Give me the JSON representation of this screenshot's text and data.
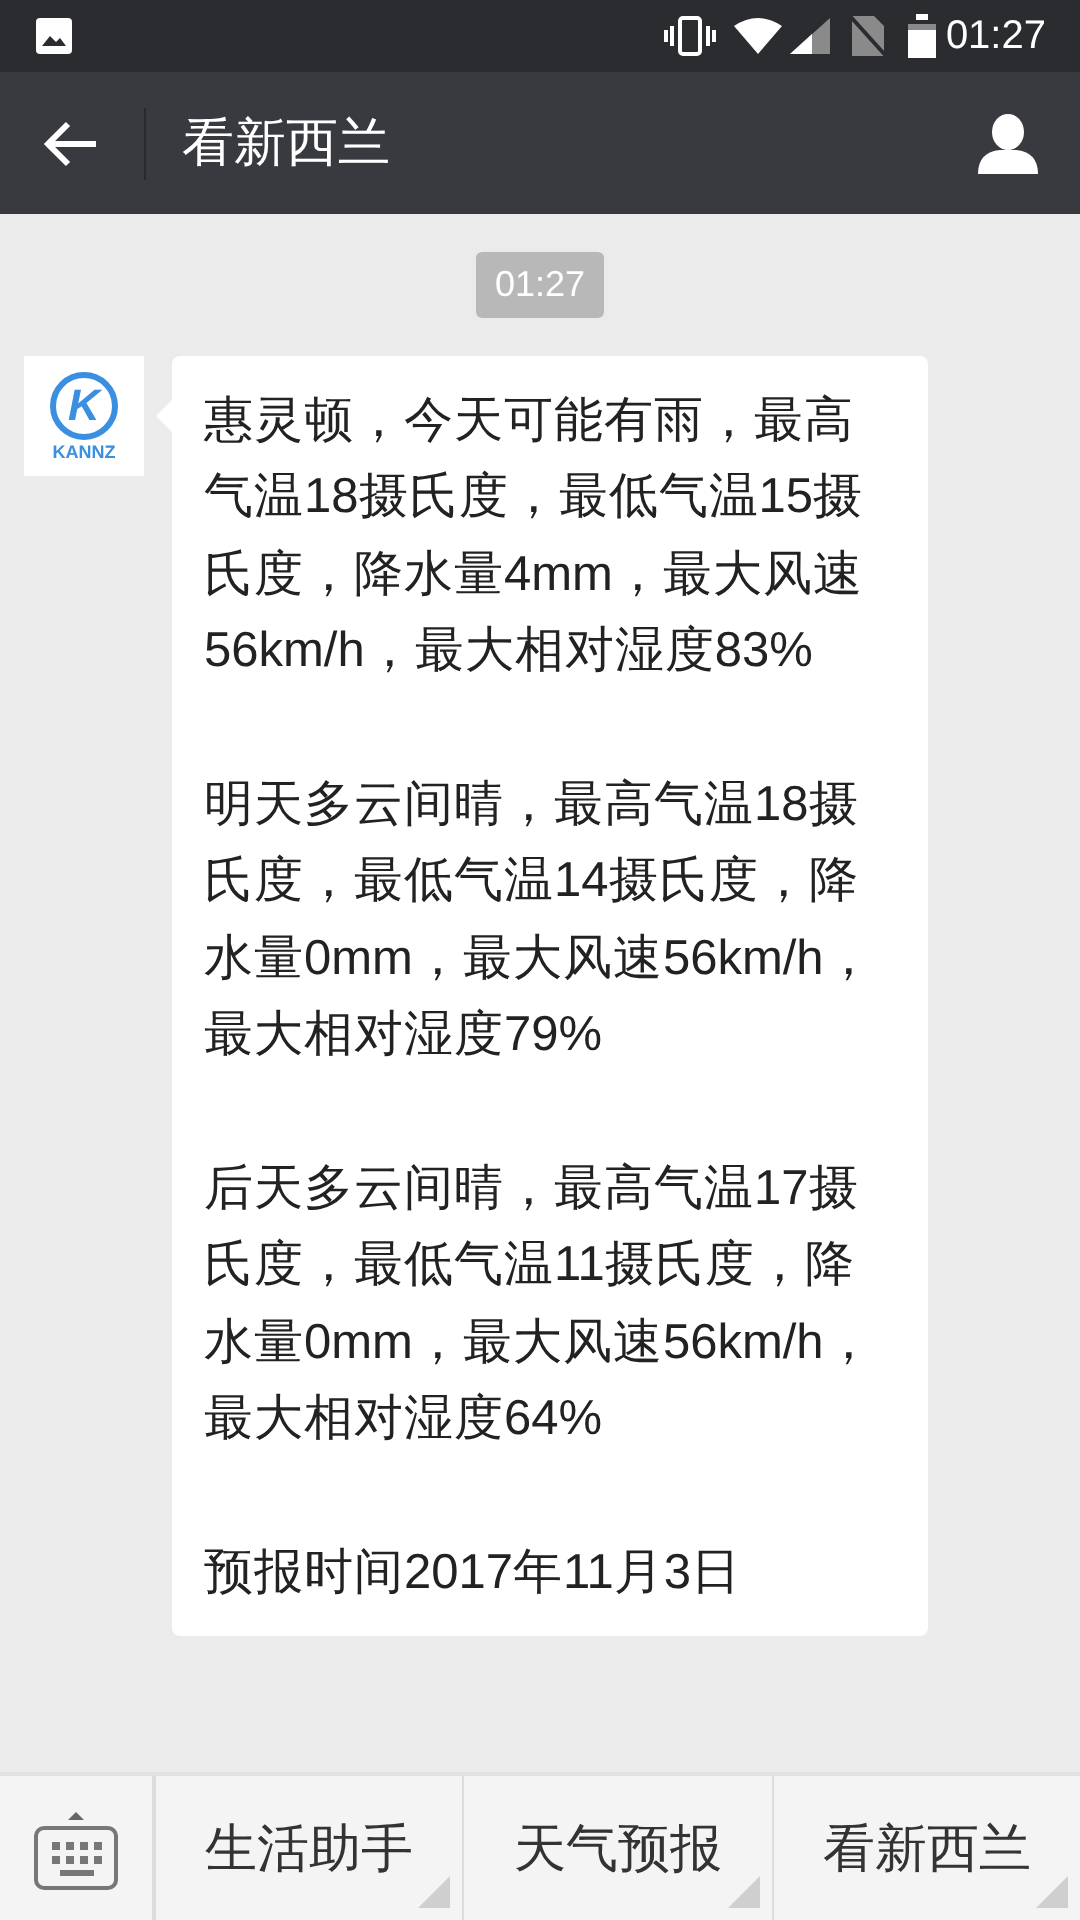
{
  "status_bar": {
    "time": "01:27"
  },
  "header": {
    "title": "看新西兰"
  },
  "chat": {
    "timestamp": "01:27",
    "avatar": {
      "monogram": "K",
      "wordmark": "KANNZ"
    },
    "message": {
      "paragraphs": [
        "惠灵顿，今天可能有雨，最高气温18摄氏度，最低气温15摄氏度，降水量4mm，最大风速56km/h，最大相对湿度83%",
        "明天多云间晴，最高气温18摄氏度，最低气温14摄氏度，降水量0mm，最大风速56km/h，最大相对湿度79%",
        "后天多云间晴，最高气温17摄氏度，最低气温11摄氏度，降水量0mm，最大风速56km/h，最大相对湿度64%",
        "预报时间2017年11月3日"
      ]
    }
  },
  "menu_bar": {
    "items": [
      "生活助手",
      "天气预报",
      "看新西兰"
    ]
  }
}
